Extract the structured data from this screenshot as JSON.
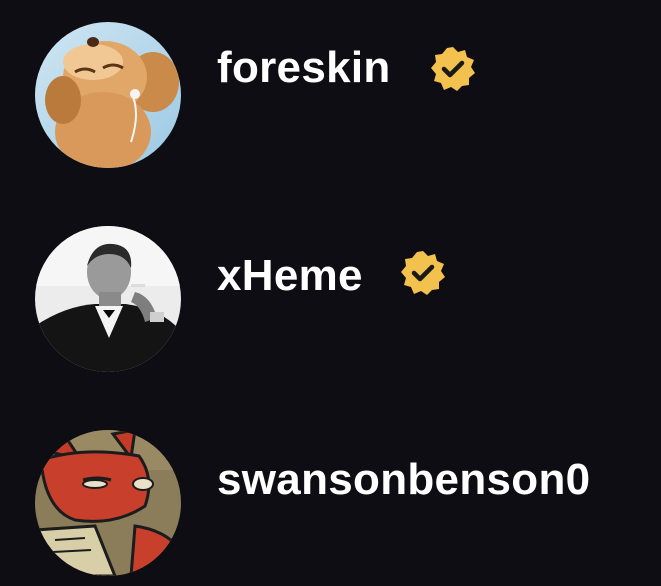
{
  "users": [
    {
      "username": "foreskin",
      "verified": true,
      "avatar_icon": "puppy-avatar"
    },
    {
      "username": "xHeme",
      "verified": true,
      "avatar_icon": "man-in-tuxedo-avatar"
    },
    {
      "username": "swansonbenson0",
      "verified": false,
      "avatar_icon": "cartoon-fox-avatar"
    }
  ],
  "colors": {
    "background": "#0e0d13",
    "text": "#ffffff",
    "verified_badge": "#f2c14e",
    "verified_check": "#1a1a1a"
  }
}
